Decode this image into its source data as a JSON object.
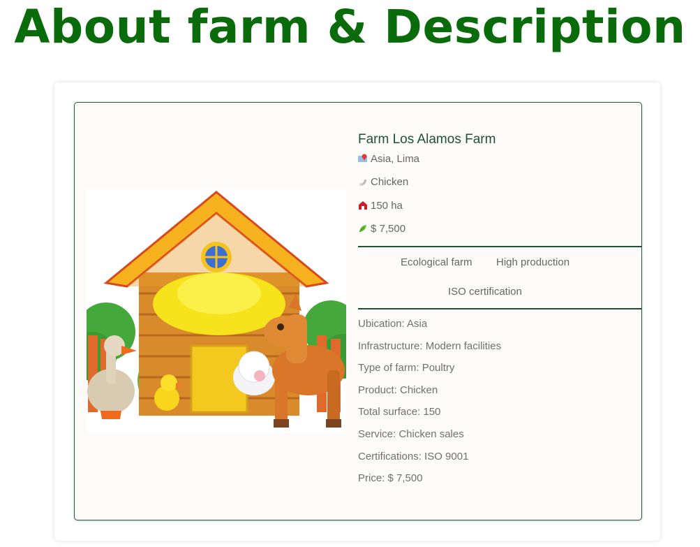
{
  "header": {
    "title": "About farm & Description"
  },
  "farm": {
    "name": "Farm Los Alamos Farm",
    "location": "Asia, Lima",
    "product": "Chicken",
    "area": "150 ha",
    "price": "$ 7,500",
    "icons": {
      "location": "map-pin-icon",
      "product": "chicken-leg-icon",
      "area": "barn-icon",
      "price": "leaf-icon"
    },
    "image_alt": "cartoon farm house with goose, duckling, lamb and horse"
  },
  "tags": [
    "Ecological farm",
    "High production",
    "ISO certification"
  ],
  "details": [
    "Ubication: Asia",
    "Infrastructure: Modern facilities",
    "Type of farm: Poultry",
    "Product: Chicken",
    "Total surface: 150",
    "Service: Chicken sales",
    "Certifications: ISO 9001",
    "Price: $ 7,500"
  ],
  "colors": {
    "title": "#0a6b0a",
    "card_border": "#1e5b3d",
    "name": "#1f4f36",
    "text": "#666666",
    "card_bg": "#fcfbf9"
  }
}
